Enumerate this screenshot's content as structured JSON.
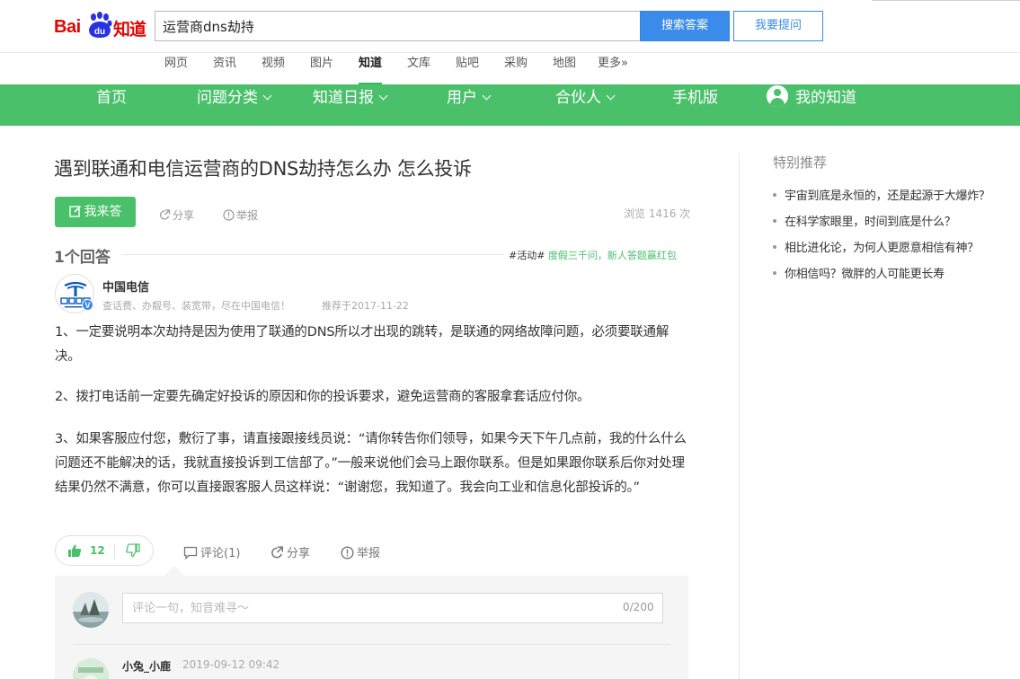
{
  "header": {
    "logo_bai": "Bai",
    "logo_du": "du",
    "logo_zhidao": "知道",
    "search_value": "运营商dns劫持",
    "search_button": "搜索答案",
    "ask_button": "我要提问"
  },
  "channels": [
    "网页",
    "资讯",
    "视频",
    "图片",
    "知道",
    "文库",
    "贴吧",
    "采购",
    "地图",
    "更多»"
  ],
  "active_channel": "知道",
  "nav": {
    "home": "首页",
    "category": "问题分类",
    "daily": "知道日报",
    "users": "用户",
    "partner": "合伙人",
    "mobile": "手机版",
    "mine": "我的知道"
  },
  "question": {
    "title": "遇到联通和电信运营商的DNS劫持怎么办 怎么投诉",
    "answer_button": "我来答",
    "share": "分享",
    "report": "举报",
    "views": "浏览 1416 次"
  },
  "answers": {
    "count_label": "1个回答",
    "promo_tag": "#活动#",
    "promo_text": "度假三千问，新人答题赢红包"
  },
  "answer": {
    "user_name": "中国电信",
    "verified_mark": "V",
    "user_desc": "查话费、办靓号、装宽带，尽在中国电信！",
    "date": "推荐于2017-11-22",
    "paragraphs": [
      "1、一定要说明本次劫持是因为使用了联通的DNS所以才出现的跳转，是联通的网络故障问题，必须要联通解决。",
      "2、拨打电话前一定要先确定好投诉的原因和你的投诉要求，避免运营商的客服拿套话应付你。",
      "3、如果客服应付您，敷衍了事，请直接跟接线员说：“请你转告你们领导，如果今天下午几点前，我的什么什么问题还不能解决的话，我就直接投诉到工信部了。”一般来说他们会马上跟你联系。但是如果跟你联系后你对处理结果仍然不满意，你可以直接跟客服人员这样说：“谢谢您，我知道了。我会向工业和信息化部投诉的。”"
    ],
    "likes": "12",
    "comment": "评论(1)",
    "share": "分享",
    "report": "举报"
  },
  "comments": {
    "placeholder": "评论一句，知音难寻～",
    "counter": "0/200",
    "items": [
      {
        "name": "小兔_小鹿",
        "time": "2019-09-12 09:42"
      }
    ]
  },
  "sidebar": {
    "title": "特别推荐",
    "items": [
      "宇宙到底是永恒的，还是起源于大爆炸？",
      "在科学家眼里，时间到底是什么？",
      "相比进化论，为何人更愿意相信有神？",
      "你相信吗？微胖的人可能更长寿"
    ]
  },
  "colors": {
    "brand_green": "#4ac06b",
    "search_blue": "#3a8bea",
    "baidu_red": "#e10602"
  }
}
